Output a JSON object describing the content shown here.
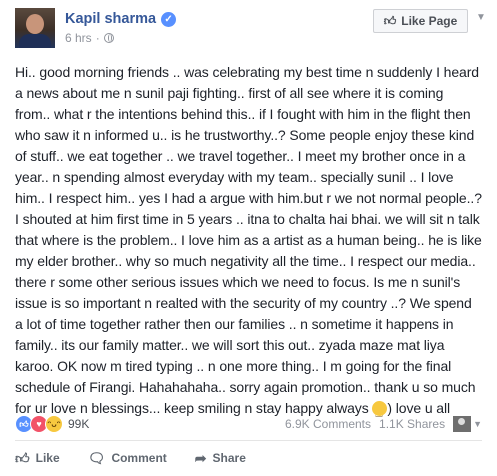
{
  "post": {
    "author": "Kapil sharma",
    "time": "6 hrs",
    "time_separator": "·",
    "like_page_label": "Like Page",
    "text": "Hi.. good morning friends .. was celebrating my best time n suddenly I heard a news about me n sunil paji fighting.. first of all see where it is coming from.. what r the intentions behind this.. if I fought with him in the flight then who saw it n informed u.. is he trustworthy..? Some people enjoy these kind of stuff.. we eat together .. we travel together.. I meet my brother once in a year.. n spending almost everyday with my team.. specially sunil .. I love him.. I respect him.. yes I had a argue with him.but r we not normal people..?I shouted at him first time in 5 years .. itna to chalta hai bhai. we will sit n talk that where is the problem.. I love him as a artist as a human being.. he is like my elder brother.. why so much negativity all the time.. I respect our media.. there r some other serious issues which we need to focus. Is me n sunil's issue is so important n realted with the security of my country ..? We spend a lot of time together rather then our families .. n sometime it happens in family.. its our family matter.. we will sort this out.. zyada maze mat liya karoo. OK now m tired typing .. n one more thing.. I m going for the final schedule of Firangi. Hahahahaha.. sorry again promotion.. thank u so much for ur love n blessings... keep smiling n stay happy always",
    "text_tail": ") love u all"
  },
  "stats": {
    "reactions_count": "99K",
    "comments": "6.9K Comments",
    "shares": "1.1K Shares"
  },
  "actions": {
    "like": "Like",
    "comment": "Comment",
    "share": "Share"
  },
  "icons": {
    "verified": "verified-badge-icon",
    "globe": "globe-icon",
    "like": "thumbs-up-icon",
    "love": "heart-icon",
    "haha": "laughing-emoji-icon",
    "smile": "smiley-emoji-icon"
  },
  "colors": {
    "author_link": "#365899",
    "verified": "#5890ff",
    "love": "#f25268",
    "haha": "#f7c83f",
    "meta_text": "#90949c"
  }
}
